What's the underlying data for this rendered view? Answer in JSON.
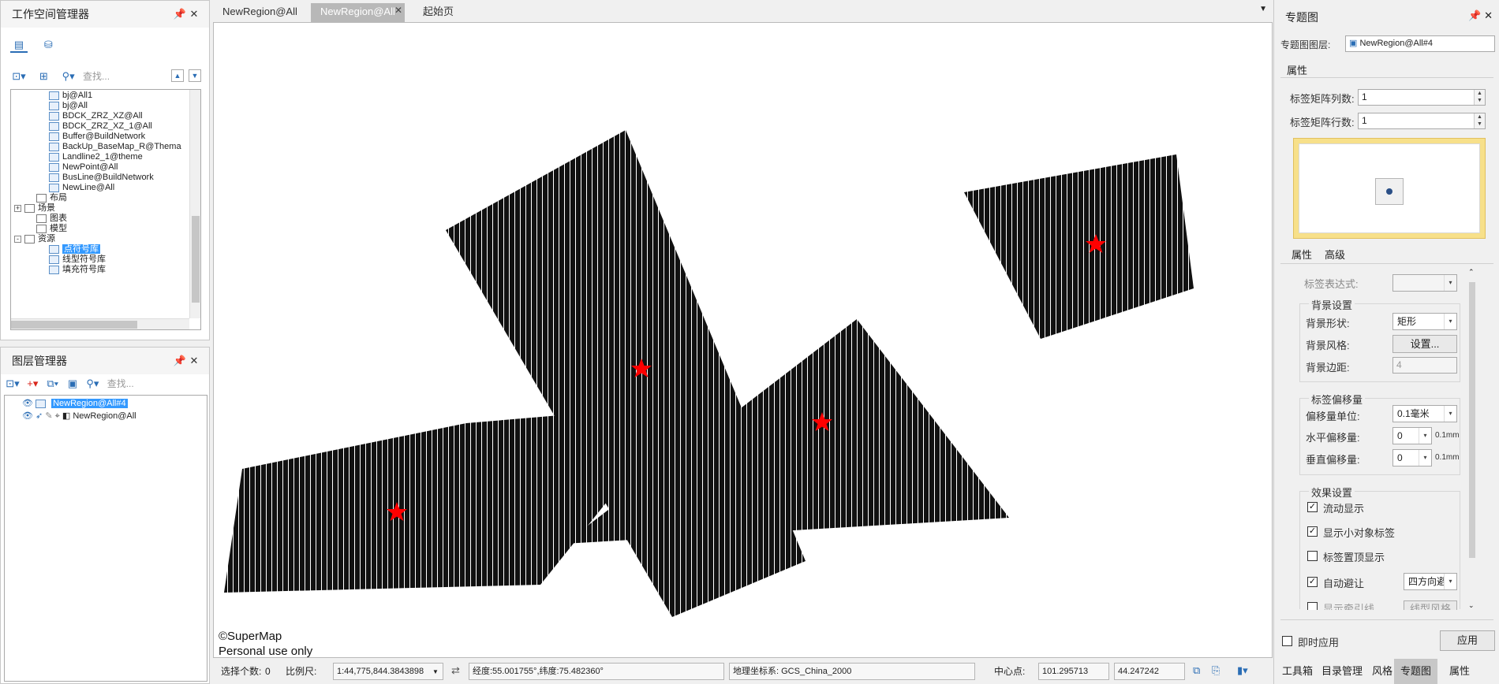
{
  "workspace": {
    "title": "工作空间管理器",
    "search_placeholder": "查找...",
    "tree": [
      {
        "label": "bj@All1",
        "indent": 3,
        "icon": "dataset-region-icon",
        "y": 0
      },
      {
        "label": "bj@All",
        "indent": 3,
        "icon": "dataset-region-icon",
        "y": 1
      },
      {
        "label": "BDCK_ZRZ_XZ@All",
        "indent": 3,
        "icon": "dataset-region-icon",
        "y": 2
      },
      {
        "label": "BDCK_ZRZ_XZ_1@All",
        "indent": 3,
        "icon": "dataset-region-icon",
        "y": 3
      },
      {
        "label": "Buffer@BuildNetwork",
        "indent": 3,
        "icon": "dataset-region-icon",
        "y": 4
      },
      {
        "label": "BackUp_BaseMap_R@Thema",
        "indent": 3,
        "icon": "dataset-region-icon",
        "y": 5
      },
      {
        "label": "Landline2_1@theme",
        "indent": 3,
        "icon": "dataset-region-icon",
        "y": 6
      },
      {
        "label": "NewPoint@All",
        "indent": 3,
        "icon": "dataset-region-icon",
        "y": 7
      },
      {
        "label": "BusLine@BuildNetwork",
        "indent": 3,
        "icon": "dataset-region-icon",
        "y": 8
      },
      {
        "label": "NewLine@All",
        "indent": 3,
        "icon": "dataset-region-icon",
        "y": 9
      },
      {
        "label": "布局",
        "indent": 2,
        "icon": "layout-icon",
        "y": 10
      },
      {
        "label": "场景",
        "indent": 1,
        "icon": "scene-icon",
        "y": 11,
        "expander": "+"
      },
      {
        "label": "图表",
        "indent": 2,
        "icon": "chart-icon",
        "y": 12
      },
      {
        "label": "模型",
        "indent": 2,
        "icon": "model-icon",
        "y": 13
      },
      {
        "label": "资源",
        "indent": 1,
        "icon": "resources-icon",
        "y": 14,
        "expander": "-"
      },
      {
        "label": "点符号库",
        "indent": 3,
        "icon": "symbol-lib-icon",
        "y": 15,
        "selected": true
      },
      {
        "label": "线型符号库",
        "indent": 3,
        "icon": "symbol-lib-icon",
        "y": 16
      },
      {
        "label": "填充符号库",
        "indent": 3,
        "icon": "symbol-lib-icon",
        "y": 17
      }
    ]
  },
  "layers": {
    "title": "图层管理器",
    "search_placeholder": "查找...",
    "items": [
      {
        "label": "NewRegion@All#4",
        "selected": true
      },
      {
        "label": "NewRegion@All",
        "selected": false
      }
    ]
  },
  "map_tabs": [
    "NewRegion@All",
    "NewRegion@All",
    "起始页"
  ],
  "map": {
    "copyright": "©SuperMap",
    "personal": "Personal use only"
  },
  "status": {
    "selected_label": "选择个数:",
    "selected_count": "0",
    "scale_label": "比例尺:",
    "scale_value": "1:44,775,844.3843898",
    "coords": "经度:55.001755°,纬度:75.482360°",
    "crs": "地理坐标系: GCS_China_2000",
    "center_label": "中心点:",
    "center_x": "101.295713",
    "center_y": "44.247242"
  },
  "thematic": {
    "title": "专题图",
    "layer_label": "专题图图层:",
    "layer_value": "NewRegion@All#4",
    "section_attr": "属性",
    "matrix_cols_label": "标签矩阵列数:",
    "matrix_cols_value": "1",
    "matrix_rows_label": "标签矩阵行数:",
    "matrix_rows_value": "1",
    "sub_tabs": [
      "属性",
      "高级"
    ],
    "expr_label": "标签表达式:",
    "bg_group": "背景设置",
    "bg_shape_label": "背景形状:",
    "bg_shape_value": "矩形",
    "bg_style_label": "背景风格:",
    "bg_style_button": "设置...",
    "bg_margin_label": "背景边距:",
    "bg_margin_value": "4",
    "offset_group": "标签偏移量",
    "offset_unit_label": "偏移量单位:",
    "offset_unit_value": "0.1毫米",
    "h_offset_label": "水平偏移量:",
    "h_offset_value": "0",
    "h_offset_unit": "0.1mm",
    "v_offset_label": "垂直偏移量:",
    "v_offset_value": "0",
    "v_offset_unit": "0.1mm",
    "effect_group": "效果设置",
    "cb_flow": "流动显示",
    "cb_small": "显示小对象标签",
    "cb_top": "标签置顶显示",
    "cb_avoid": "自动避让",
    "avoid_value": "四方向避",
    "cb_leader": "显示牵引线",
    "leader_btn": "线型风格",
    "instant_label": "即时应用",
    "apply_button": "应用",
    "bottom_tabs": [
      "工具箱",
      "目录管理",
      "风格",
      "专题图",
      "属性"
    ]
  },
  "colors": {
    "polygon_fill": "#111111",
    "hatch": "#ffffff",
    "star": "#ff0000",
    "selection": "#3399ff"
  }
}
